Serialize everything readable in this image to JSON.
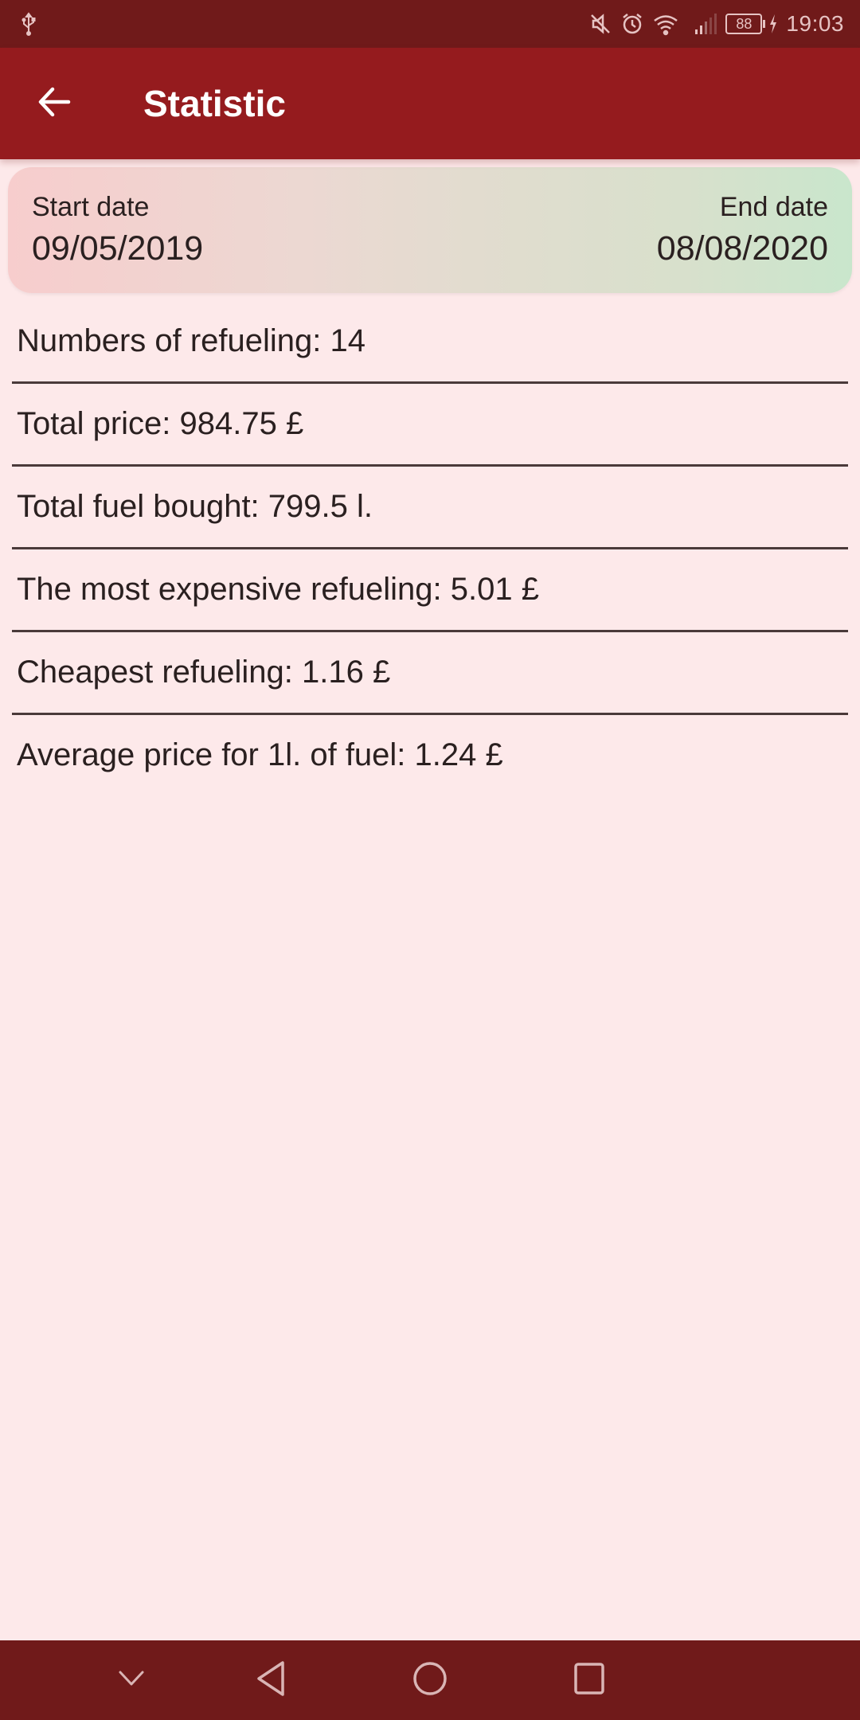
{
  "status_bar": {
    "time": "19:03",
    "battery_level": "88",
    "icons": [
      "usb-icon",
      "mute-icon",
      "alarm-icon",
      "wifi-icon",
      "signal-icon",
      "battery-icon",
      "charging-icon"
    ]
  },
  "app_bar": {
    "title": "Statistic",
    "back_icon": "arrow-left-icon"
  },
  "date_range": {
    "start_label": "Start date",
    "start_value": "09/05/2019",
    "end_label": "End date",
    "end_value": "08/08/2020"
  },
  "stats": [
    {
      "text": "Numbers of refueling: 14"
    },
    {
      "text": "Total price: 984.75 £"
    },
    {
      "text": "Total fuel bought: 799.5 l."
    },
    {
      "text": "The most expensive refueling: 5.01 £"
    },
    {
      "text": "Cheapest refueling: 1.16 £"
    },
    {
      "text": "Average price for 1l. of fuel: 1.24 £"
    }
  ],
  "nav_bar": {
    "buttons": [
      "hide-keyboard",
      "back",
      "home",
      "recents"
    ]
  },
  "colors": {
    "app_bar": "#951b1e",
    "status_bar": "#701a1a",
    "background": "#fde9ea",
    "card_gradient_start": "#f7cdcd",
    "card_gradient_end": "#c9e6cc"
  }
}
